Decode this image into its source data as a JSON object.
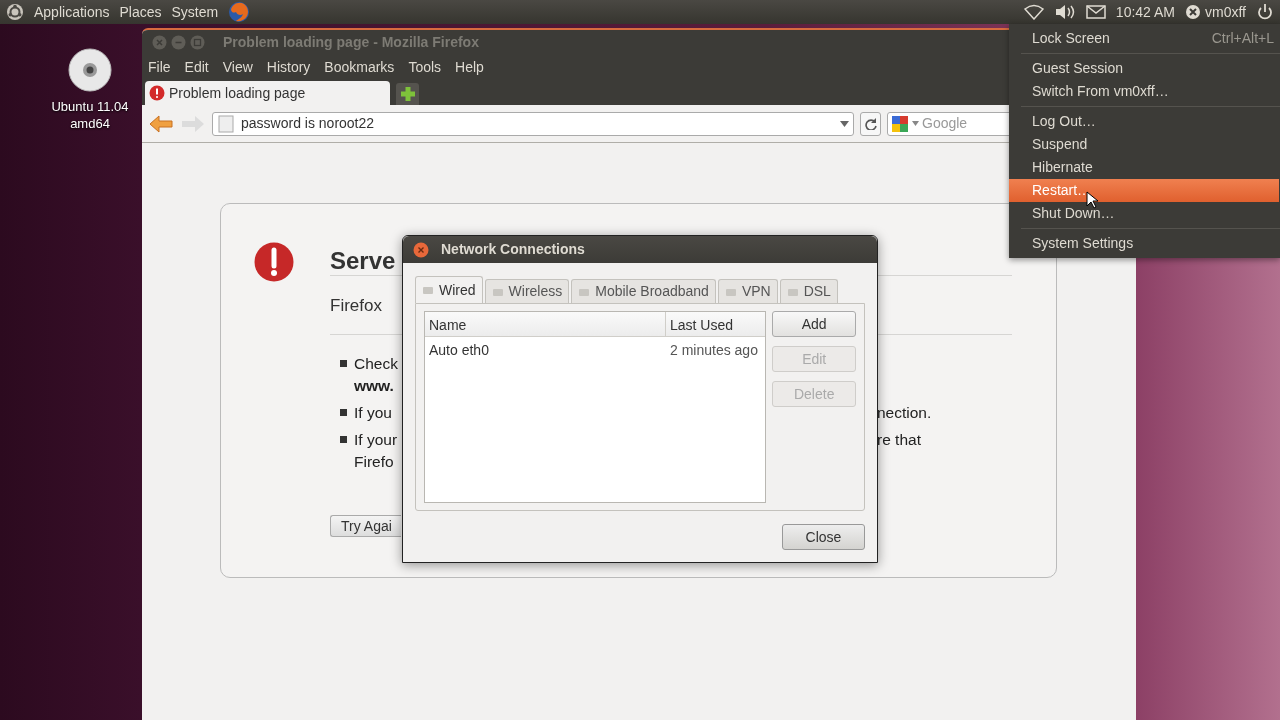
{
  "panel": {
    "menus": [
      "Applications",
      "Places",
      "System"
    ],
    "clock": "10:42 AM",
    "user": "vm0xff"
  },
  "desktop_icons": [
    {
      "label": "Ubuntu 11.04 amd64"
    }
  ],
  "firefox": {
    "title": "Problem loading page - Mozilla Firefox",
    "menus": [
      "File",
      "Edit",
      "View",
      "History",
      "Bookmarks",
      "Tools",
      "Help"
    ],
    "tabs": [
      {
        "label": "Problem loading page",
        "selected": true
      }
    ],
    "url": "password is noroot22",
    "search_placeholder": "Google",
    "error": {
      "heading": "Serve",
      "intro": "Firefox",
      "bullets": [
        {
          "lines": [
            {
              "text": "Check"
            },
            {
              "text": "www.",
              "bold": true
            }
          ]
        },
        {
          "lines": [
            {
              "text": "If you",
              "tail": "nection."
            }
          ]
        },
        {
          "lines": [
            {
              "text": "If your",
              "tail": "re that"
            },
            {
              "text": "Firefo"
            }
          ]
        }
      ],
      "button": "Try Agai"
    }
  },
  "dialog": {
    "title": "Network Connections",
    "tabs": [
      {
        "label": "Wired",
        "selected": true
      },
      {
        "label": "Wireless",
        "selected": false
      },
      {
        "label": "Mobile Broadband",
        "selected": false
      },
      {
        "label": "VPN",
        "selected": false
      },
      {
        "label": "DSL",
        "selected": false
      }
    ],
    "columns": [
      "Name",
      "Last Used"
    ],
    "rows": [
      [
        "Auto eth0",
        "2 minutes ago"
      ]
    ],
    "buttons": [
      {
        "label": "Add",
        "disabled": false
      },
      {
        "label": "Edit",
        "disabled": true
      },
      {
        "label": "Delete",
        "disabled": true
      }
    ],
    "close": "Close"
  },
  "session_menu": [
    {
      "kind": "item",
      "label": "Lock Screen",
      "shortcut": "Ctrl+Alt+L",
      "selected": false
    },
    {
      "kind": "separator"
    },
    {
      "kind": "item",
      "label": "Guest Session",
      "selected": false
    },
    {
      "kind": "item",
      "label": "Switch From vm0xff…",
      "selected": false
    },
    {
      "kind": "separator"
    },
    {
      "kind": "item",
      "label": "Log Out…",
      "selected": false
    },
    {
      "kind": "item",
      "label": "Suspend",
      "selected": false
    },
    {
      "kind": "item",
      "label": "Hibernate",
      "selected": false
    },
    {
      "kind": "item",
      "label": "Restart…",
      "selected": true
    },
    {
      "kind": "item",
      "label": "Shut Down…",
      "selected": false
    },
    {
      "kind": "separator"
    },
    {
      "kind": "item",
      "label": "System Settings",
      "selected": false
    }
  ]
}
